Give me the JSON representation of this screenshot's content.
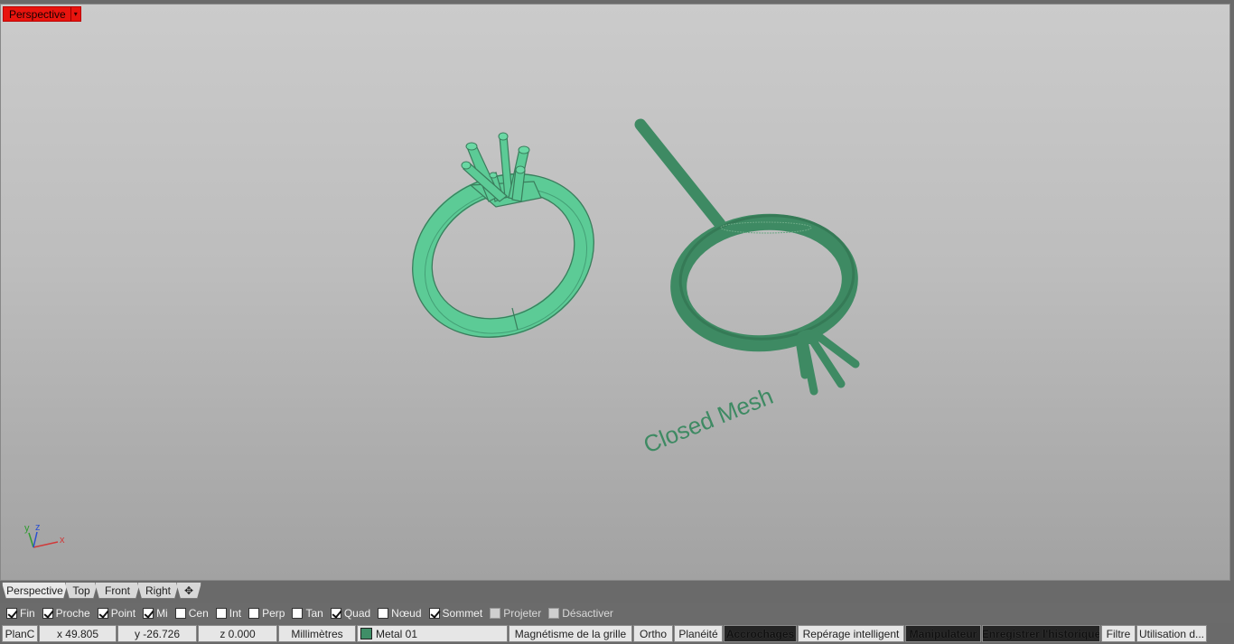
{
  "viewport": {
    "label": "Perspective",
    "menu_glyph": "▾",
    "annotation_text": "Closed Mesh",
    "axis": {
      "x": "x",
      "y": "y",
      "z": "z"
    },
    "model_color": "#5fcf99",
    "mesh_color": "#3e8a63"
  },
  "view_tabs": [
    {
      "label": "Perspective",
      "active": true
    },
    {
      "label": "Top"
    },
    {
      "label": "Front"
    },
    {
      "label": "Right"
    },
    {
      "label": "✥"
    }
  ],
  "osnaps": [
    {
      "label": "Fin",
      "checked": true
    },
    {
      "label": "Proche",
      "checked": true
    },
    {
      "label": "Point",
      "checked": true
    },
    {
      "label": "Mi",
      "checked": true
    },
    {
      "label": "Cen",
      "checked": false
    },
    {
      "label": "Int",
      "checked": false
    },
    {
      "label": "Perp",
      "checked": false
    },
    {
      "label": "Tan",
      "checked": false
    },
    {
      "label": "Quad",
      "checked": true
    },
    {
      "label": "Nœud",
      "checked": false
    },
    {
      "label": "Sommet",
      "checked": true
    },
    {
      "label": "Projeter",
      "checked": false,
      "disabled": true
    },
    {
      "label": "Désactiver",
      "checked": false,
      "disabled": true
    }
  ],
  "status": {
    "cplane": "PlanC",
    "x": "x 49.805",
    "y": "y -26.726",
    "z": "z 0.000",
    "units": "Millimètres",
    "layer": "Metal 01",
    "layer_color": "#3f8e67",
    "grid_snap": "Magnétisme de la grille",
    "ortho": "Ortho",
    "planar": "Planéité",
    "osnap": "Accrochages",
    "smarttrack": "Repérage intelligent",
    "gumball": "Manipulateur",
    "history": "Enregistrer l'historique",
    "filter": "Filtre",
    "usage": "Utilisation d..."
  }
}
